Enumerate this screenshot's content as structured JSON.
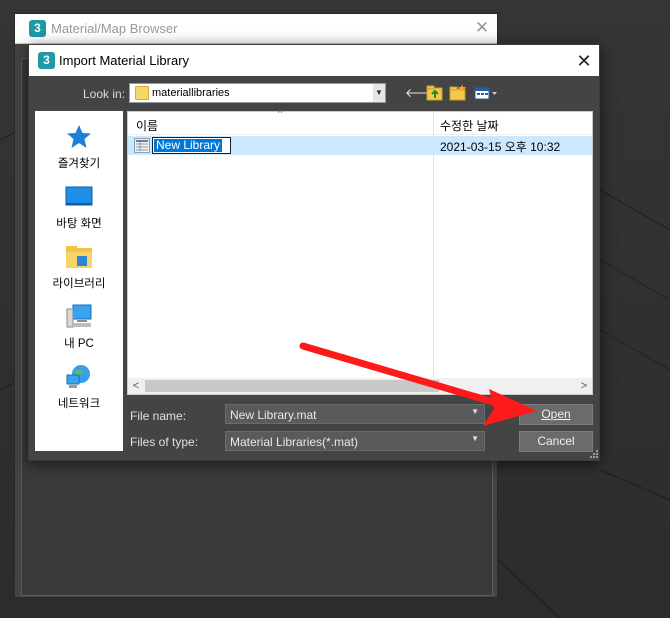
{
  "browser_window": {
    "title": "Material/Map Browser",
    "close_glyph": "✕",
    "app_icon_glyph": "3"
  },
  "dialog": {
    "title": "Import Material Library",
    "close_glyph": "✕",
    "app_icon_glyph": "3",
    "look_in": {
      "label": "Look in:",
      "value": "materiallibraries"
    },
    "toolbar": {
      "back_icon": "back-arrow-icon",
      "up_icon": "up-folder-icon",
      "new_folder_icon": "new-folder-icon",
      "views_icon": "view-menu-icon"
    },
    "places": [
      {
        "label": "즐겨찾기",
        "icon": "star-icon"
      },
      {
        "label": "바탕 화면",
        "icon": "desktop-icon"
      },
      {
        "label": "라이브러리",
        "icon": "library-icon"
      },
      {
        "label": "내 PC",
        "icon": "computer-icon"
      },
      {
        "label": "네트워크",
        "icon": "network-icon"
      }
    ],
    "file_list": {
      "columns": [
        "이름",
        "수정한 날짜"
      ],
      "rows": [
        {
          "name": "New Library",
          "modified": "2021-03-15 오후 10:32"
        }
      ]
    },
    "file_name": {
      "label": "File name:",
      "value": "New Library.mat"
    },
    "file_type": {
      "label": "Files of type:",
      "value": "Material Libraries(*.mat)"
    },
    "buttons": {
      "open": "Open",
      "cancel": "Cancel"
    }
  },
  "annotation": {
    "arrow_color": "#ff1a1a"
  }
}
